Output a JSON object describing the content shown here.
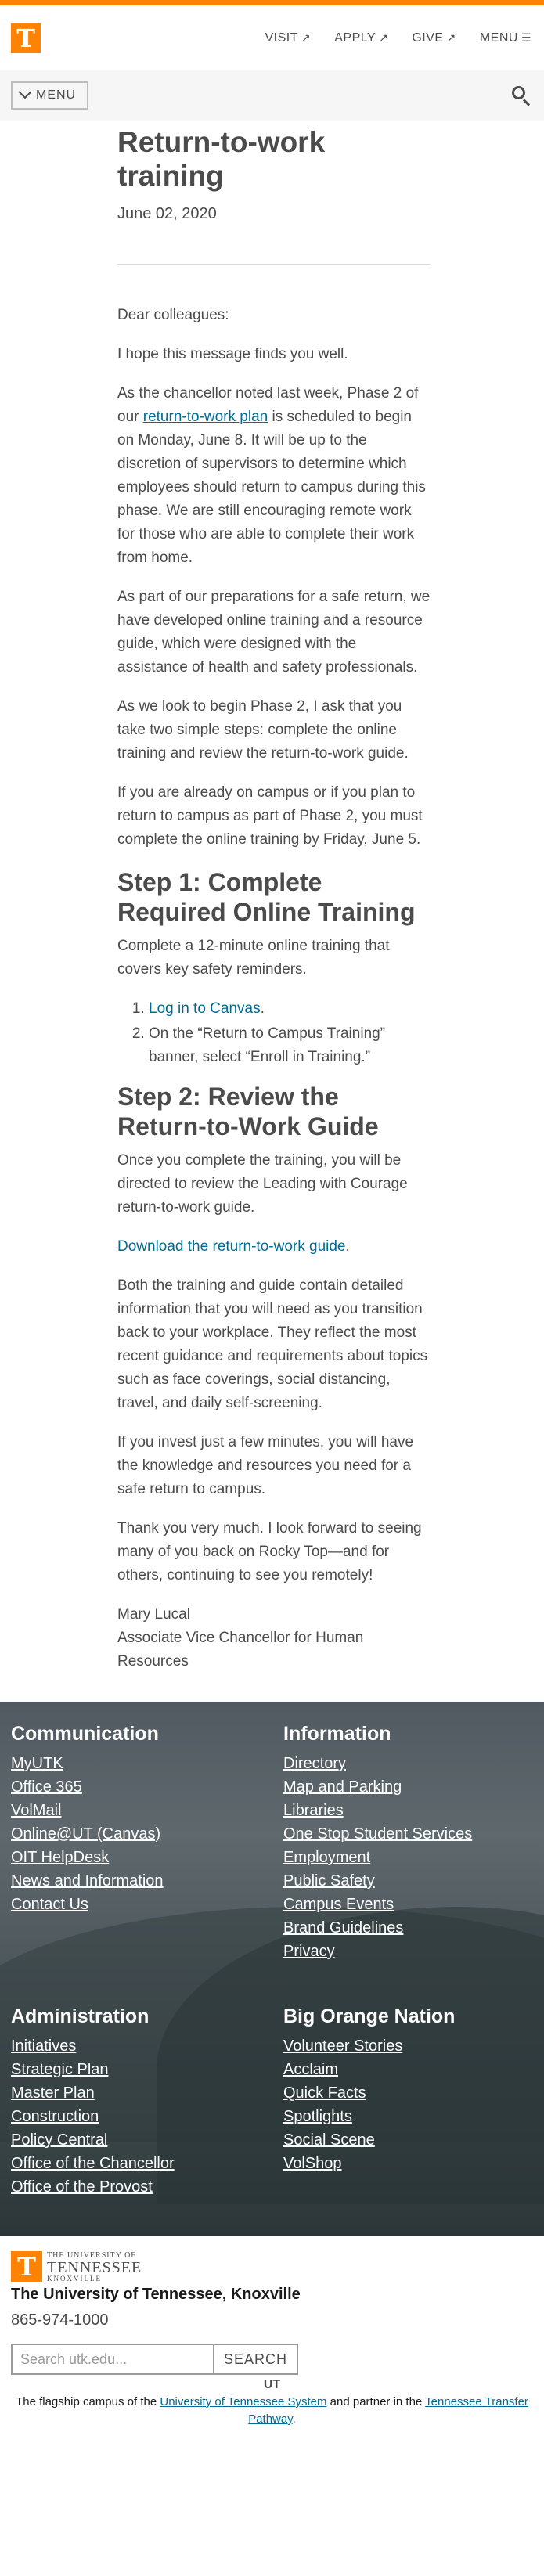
{
  "header": {
    "logo_letter": "T",
    "nav": [
      {
        "label": "VISIT",
        "suffix": "↗"
      },
      {
        "label": "APPLY",
        "suffix": "↗"
      },
      {
        "label": "GIVE",
        "suffix": "↗"
      },
      {
        "label": "MENU",
        "suffix": "☰"
      }
    ]
  },
  "menubar": {
    "menu_label": "MENU"
  },
  "article": {
    "title": "Return-to-work training",
    "date": "June 02, 2020",
    "greeting": "Dear colleagues:",
    "p1": "I hope this message finds you well.",
    "p2_before": "As the chancellor noted last week, Phase 2 of our ",
    "p2_link": "return-to-work plan",
    "p2_after": " is scheduled to begin on Monday, June 8. It will be up to the discretion of supervisors to determine which employees should return to campus during this phase. We are still encouraging remote work for those who are able to complete their work from home.",
    "p3": "As part of our preparations for a safe return, we have developed online training and a resource guide, which were designed with the assistance of health and safety professionals.",
    "p4": "As we look to begin Phase 2, I ask that you take two simple steps: complete the online training and review the return-to-work guide.",
    "p5": "If you are already on campus or if you plan to return to campus as part of Phase 2, you must complete the online training by Friday, June 5.",
    "step1_heading": "Step 1: Complete Required Online Training",
    "step1_text": "Complete a 12-minute online training that covers key safety reminders.",
    "step1_item1_link": "Log in to Canvas",
    "step1_item1_after": ".",
    "step1_item2": "On the “Return to Campus Training” banner, select “Enroll in Training.”",
    "step2_heading": "Step 2: Review the Return-to-Work Guide",
    "step2_text": "Once you complete the training, you will be directed to review the Leading with Courage return-to-work guide.",
    "download_link": "Download the return-to-work guide",
    "download_after": ".",
    "p6": "Both the training and guide contain detailed information that you will need as you transition back to your workplace. They reflect the most recent guidance and requirements about topics such as face coverings, social distancing, travel, and daily self-screening.",
    "p7": "If you invest just a few minutes, you will have the knowledge and resources you need for a safe return to campus.",
    "p8": "Thank you very much. I look forward to seeing many of you back on Rocky Top—and for others, continuing to see you remotely!",
    "signer_name": "Mary Lucal",
    "signer_title": "Associate Vice Chancellor for Human Resources"
  },
  "footer": {
    "columns": [
      {
        "heading": "Communication",
        "links": [
          "MyUTK",
          "Office 365",
          "VolMail",
          "Online@UT (Canvas)",
          "OIT HelpDesk",
          "News and Information",
          "Contact Us"
        ]
      },
      {
        "heading": "Information",
        "links": [
          "Directory",
          "Map and Parking",
          "Libraries",
          "One Stop Student Services",
          "Employment",
          "Public Safety",
          "Campus Events",
          "Brand Guidelines",
          "Privacy"
        ]
      },
      {
        "heading": "Administration",
        "links": [
          "Initiatives",
          "Strategic Plan",
          "Master Plan",
          "Construction",
          "Policy Central",
          "Office of the Chancellor",
          "Office of the Provost"
        ]
      },
      {
        "heading": "Big Orange Nation",
        "links": [
          "Volunteer Stories",
          "Acclaim",
          "Quick Facts",
          "Spotlights",
          "Social Scene",
          "VolShop"
        ]
      }
    ],
    "logo_line1": "THE UNIVERSITY OF",
    "logo_line2": "TENNESSEE",
    "logo_line3": "KNOXVILLE",
    "campus_name": "The University of Tennessee, Knoxville",
    "phone": "865-974-1000",
    "search_placeholder": "Search utk.edu...",
    "search_button": "SEARCH",
    "ut_mark": "UT",
    "flagship_before": "The flagship campus of the ",
    "flagship_link1": "University of Tennessee System",
    "flagship_middle": " and partner in the ",
    "flagship_link2": "Tennessee Transfer Pathway",
    "flagship_after": "."
  },
  "colors": {
    "orange": "#ff8200",
    "link": "#006c93",
    "text": "#4b4b4b"
  }
}
